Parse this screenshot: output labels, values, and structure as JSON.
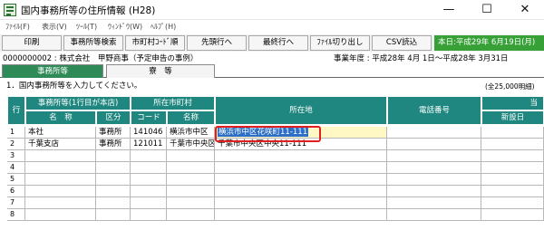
{
  "window": {
    "title": "国内事務所等の住所情報 (H28)",
    "controls": [
      "—",
      "☐",
      "✕"
    ]
  },
  "menu": [
    "ﾌｧｲﾙ(F)",
    "表示(V)",
    "ﾂｰﾙ(T)",
    "ｳｨﾝﾄﾞｳ(W)",
    "ﾍﾙﾌﾟ(H)"
  ],
  "toolbar": {
    "buttons": [
      "印刷",
      "事務所等検索",
      "市町村ｺｰﾄﾞ順",
      "先頭行へ",
      "最終行へ",
      "ﾌｧｲﾙ切り出し",
      "CSV読込"
    ],
    "today": "本日:平成29年 6月19日(月)"
  },
  "info": {
    "company": "0000000002 : 株式会社　甲野商事（予定申告の事例）",
    "fiscal_year": "事業年度 : 平成28年 4月 1日～平成28年 3月31日"
  },
  "tabs": [
    "事務所等",
    "寮　等"
  ],
  "instruction": "1．国内事務所等を入力してください。",
  "count": "(全25,000明細)",
  "grid": {
    "header_top": {
      "row": "行",
      "office_group": "事務所等(1行目が本店)",
      "city_group": "所在市町村",
      "location": "所在地",
      "phone": "電話番号",
      "extra": "当"
    },
    "header_sub": {
      "name": "名　称",
      "category": "区分",
      "code": "コード",
      "city_name": "名称",
      "new_establish": "新設日"
    },
    "rows": [
      {
        "no": "1",
        "name": "本社",
        "category": "事務所",
        "code": "141046",
        "city": "横浜市中区",
        "address": "横浜市中区花咲町11-111",
        "phone": ""
      },
      {
        "no": "2",
        "name": "千葉支店",
        "category": "事務所",
        "code": "121011",
        "city": "千葉市中央区",
        "address": "千葉市中央区中央11-111",
        "phone": ""
      },
      {
        "no": "3",
        "name": "",
        "category": "",
        "code": "",
        "city": "",
        "address": "",
        "phone": ""
      },
      {
        "no": "4",
        "name": "",
        "category": "",
        "code": "",
        "city": "",
        "address": "",
        "phone": ""
      },
      {
        "no": "5",
        "name": "",
        "category": "",
        "code": "",
        "city": "",
        "address": "",
        "phone": ""
      },
      {
        "no": "6",
        "name": "",
        "category": "",
        "code": "",
        "city": "",
        "address": "",
        "phone": ""
      },
      {
        "no": "7",
        "name": "",
        "category": "",
        "code": "",
        "city": "",
        "address": "",
        "phone": ""
      },
      {
        "no": "8",
        "name": "",
        "category": "",
        "code": "",
        "city": "",
        "address": "",
        "phone": ""
      }
    ]
  }
}
